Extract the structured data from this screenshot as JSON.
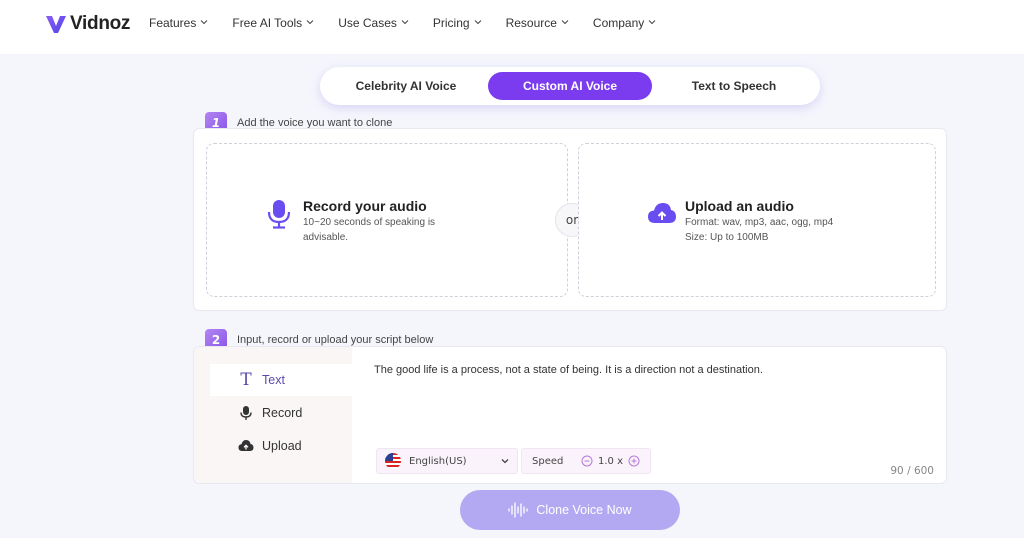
{
  "nav": {
    "brand": "Vidnoz",
    "items": [
      {
        "label": "Features"
      },
      {
        "label": "Free AI Tools"
      },
      {
        "label": "Use Cases"
      },
      {
        "label": "Pricing"
      },
      {
        "label": "Resource"
      },
      {
        "label": "Company"
      }
    ]
  },
  "tabs": [
    {
      "label": "Celebrity AI Voice",
      "active": false
    },
    {
      "label": "Custom AI Voice",
      "active": true
    },
    {
      "label": "Text to Speech",
      "active": false
    }
  ],
  "step1": {
    "number": "1",
    "label": "Add the voice you want to clone",
    "record": {
      "title": "Record your audio",
      "desc": "10~20 seconds of speaking is advisable.",
      "icon": "microphone-icon"
    },
    "or_label": "or",
    "upload": {
      "title": "Upload an audio",
      "format": "Format: wav, mp3, aac, ogg, mp4",
      "size": "Size: Up to 100MB",
      "icon": "cloud-upload-icon"
    }
  },
  "step2": {
    "number": "2",
    "label": "Input, record or upload your script below",
    "modes": [
      {
        "label": "Text",
        "icon": "text-icon",
        "active": true
      },
      {
        "label": "Record",
        "icon": "microphone-icon",
        "active": false
      },
      {
        "label": "Upload",
        "icon": "cloud-upload-icon",
        "active": false
      }
    ],
    "script_text": "The good life is a process, not a state of being. It is a direction not a destination.",
    "language": "English(US)",
    "speed_label": "Speed",
    "speed_value": "1.0 x",
    "char_count": "90 / 600"
  },
  "clone_button": "Clone Voice Now",
  "colors": {
    "accent": "#7b3cf0",
    "button_disabled": "#b3a9f2",
    "icon_purple": "#6a4df0"
  }
}
